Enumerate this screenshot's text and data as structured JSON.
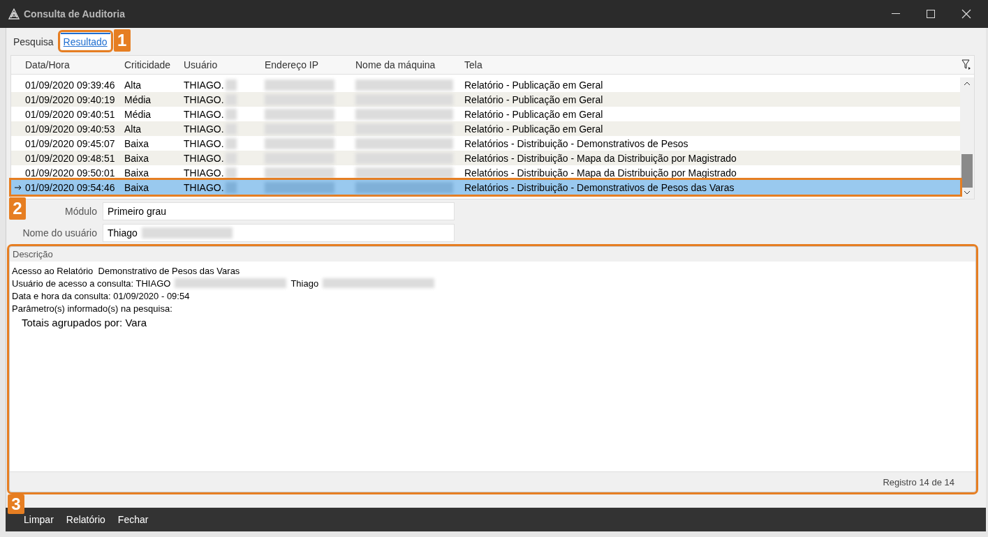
{
  "window": {
    "title": "Consulta de Auditoria"
  },
  "tabs": [
    {
      "label": "Pesquisa",
      "selected": false
    },
    {
      "label": "Resultado",
      "selected": true,
      "callout": "1"
    }
  ],
  "table": {
    "columns": [
      "Data/Hora",
      "Criticidade",
      "Usuário",
      "Endereço IP",
      "Nome da máquina",
      "Tela"
    ],
    "rows": [
      {
        "datetime": "01/09/2020 09:39:46",
        "criticidade": "Alta",
        "usuario": "THIAGO.",
        "tela": "Relatório - Publicação em Geral",
        "selected": false
      },
      {
        "datetime": "01/09/2020 09:40:19",
        "criticidade": "Média",
        "usuario": "THIAGO.",
        "tela": "Relatório - Publicação em Geral",
        "selected": false
      },
      {
        "datetime": "01/09/2020 09:40:51",
        "criticidade": "Média",
        "usuario": "THIAGO.",
        "tela": "Relatório - Publicação em Geral",
        "selected": false
      },
      {
        "datetime": "01/09/2020 09:40:53",
        "criticidade": "Alta",
        "usuario": "THIAGO.",
        "tela": "Relatório - Publicação em Geral",
        "selected": false
      },
      {
        "datetime": "01/09/2020 09:45:07",
        "criticidade": "Baixa",
        "usuario": "THIAGO.",
        "tela": "Relatórios - Distribuição - Demonstrativos de Pesos",
        "selected": false
      },
      {
        "datetime": "01/09/2020 09:48:51",
        "criticidade": "Baixa",
        "usuario": "THIAGO.",
        "tela": "Relatórios - Distribuição - Mapa da Distribuição por Magistrado",
        "selected": false
      },
      {
        "datetime": "01/09/2020 09:50:01",
        "criticidade": "Baixa",
        "usuario": "THIAGO.",
        "tela": "Relatórios - Distribuição - Mapa da Distribuição por Magistrado",
        "selected": false
      },
      {
        "datetime": "01/09/2020 09:54:46",
        "criticidade": "Baixa",
        "usuario": "THIAGO.",
        "tela": "Relatórios - Distribuição - Demonstrativos de Pesos das Varas",
        "selected": true,
        "callout": "2"
      }
    ]
  },
  "fields": [
    {
      "label": "Módulo",
      "value": "Primeiro grau",
      "redacted": false
    },
    {
      "label": "Nome do usuário",
      "value": "Thiago",
      "redacted": true
    }
  ],
  "description": {
    "title": "Descrição",
    "callout": "3",
    "lines": [
      {
        "kind": "text",
        "segments": [
          {
            "kind": "text",
            "text": "Acesso ao Relatório  Demonstrativo de Pesos das Varas"
          }
        ]
      },
      {
        "kind": "text",
        "segments": [
          {
            "kind": "text",
            "text": "Usuário de acesso a consulta: THIAGO"
          },
          {
            "kind": "redacted"
          },
          {
            "kind": "text",
            "text": "Thiago"
          },
          {
            "kind": "redacted"
          }
        ]
      },
      {
        "kind": "text",
        "segments": [
          {
            "kind": "text",
            "text": "Data e hora da consulta: 01/09/2020 - 09:54"
          }
        ]
      },
      {
        "kind": "text",
        "segments": [
          {
            "kind": "text",
            "text": "Parâmetro(s) informado(s) na pesquisa:"
          }
        ]
      },
      {
        "kind": "param",
        "segments": [
          {
            "kind": "text",
            "text": "Totais agrupados por: Vara"
          }
        ]
      }
    ],
    "status": "Registro 14 de 14"
  },
  "buttons": [
    "Limpar",
    "Relatório",
    "Fechar"
  ]
}
